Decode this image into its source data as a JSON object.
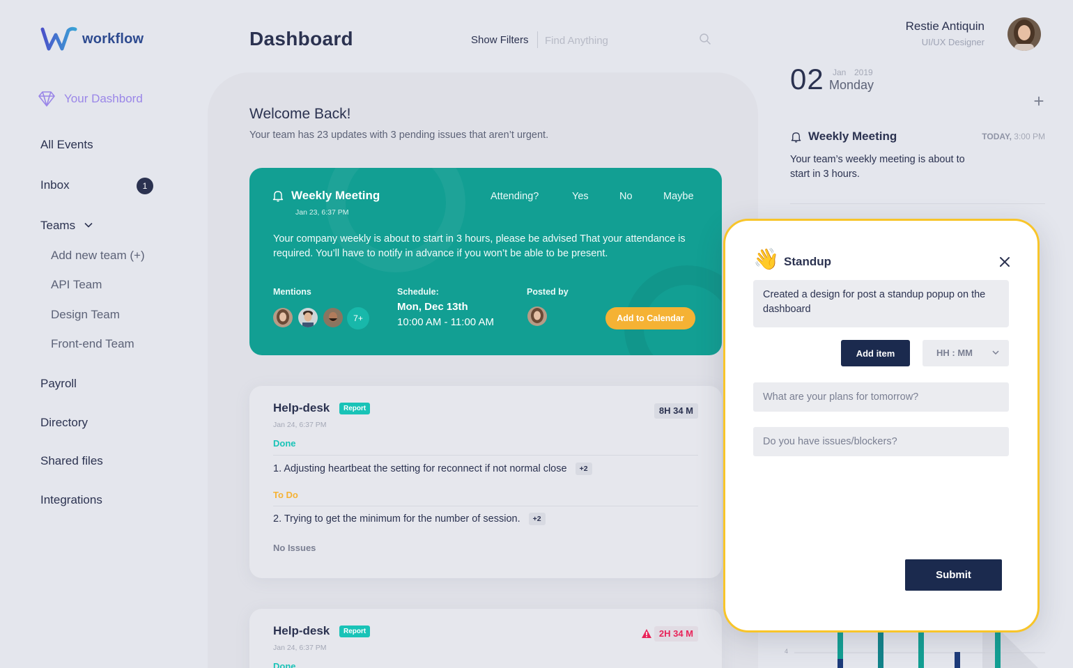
{
  "app": {
    "name": "workflow"
  },
  "sidebar": {
    "dashboard_label": "Your Dashbord",
    "items": [
      {
        "label": "All Events"
      },
      {
        "label": "Inbox",
        "badge": "1"
      },
      {
        "label": "Teams"
      },
      {
        "label": "Payroll"
      },
      {
        "label": "Directory"
      },
      {
        "label": "Shared files"
      },
      {
        "label": "Integrations"
      }
    ],
    "teams": [
      "Add new team (+)",
      "API Team",
      "Design Team",
      "Front-end Team"
    ]
  },
  "header": {
    "title": "Dashboard",
    "filters_label": "Show Filters",
    "search_placeholder": "Find Anything"
  },
  "user": {
    "name": "Restie Antiquin",
    "role": "UI/UX Designer"
  },
  "welcome": {
    "title": "Welcome Back!",
    "subtitle": "Your team has 23 updates with 3 pending issues that aren’t urgent."
  },
  "meeting": {
    "title": "Weekly Meeting",
    "date": "Jan 23, 6:37 PM",
    "attending_label": "Attending?",
    "options": [
      "Yes",
      "No",
      "Maybe"
    ],
    "body": "Your company weekly is about to start in 3 hours, please be advised That your attendance is required. You’ll have to notify in advance if you won’t be able to be present.",
    "mentions_label": "Mentions",
    "mentions_more": "7+",
    "schedule_label": "Schedule:",
    "schedule_day": "Mon, Dec 13th",
    "schedule_time": "10:00 AM - 11:00 AM",
    "posted_label": "Posted by",
    "add_calendar": "Add to Calendar"
  },
  "tasks": [
    {
      "title": "Help-desk",
      "tag": "Report",
      "date": "Jan 24, 6:37 PM",
      "duration": "8H 34 M",
      "done_label": "Done",
      "done_item": "1. Adjusting heartbeat the setting for reconnect if not normal close",
      "done_more": "+2",
      "todo_label": "To Do",
      "todo_item": "2. Trying to get the minimum for the number of session.",
      "todo_more": "+2",
      "issues": "No Issues"
    },
    {
      "title": "Help-desk",
      "tag": "Report",
      "date": "Jan 24, 6:37 PM",
      "duration": "2H 34 M",
      "done_label": "Done"
    }
  ],
  "calendar": {
    "day": "02",
    "month": "Jan",
    "year": "2019",
    "weekday": "Monday",
    "add": "+"
  },
  "reminder": {
    "title": "Weekly Meeting",
    "when_day": "TODAY,",
    "when_time": "3:00 PM",
    "body": "Your team’s weekly meeting is about to start in 3 hours."
  },
  "chart_tick": "4",
  "standup": {
    "emoji": "👋",
    "title": "Standup",
    "entry": "Created a design for post a standup popup on the dashboard",
    "add_item": "Add item",
    "time_select": "HH : MM",
    "plans_placeholder": "What are your plans for tomorrow?",
    "issues_placeholder": "Do you have issues/blockers?",
    "submit": "Submit"
  },
  "colors": {
    "background": "#e4e6ed",
    "meeting_card": "#129f93",
    "accent_yellow": "#f5b234",
    "navy": "#1b2a4e",
    "purple": "#9a86e8",
    "report_tag": "#19c3b7",
    "alert": "#e8245a"
  }
}
